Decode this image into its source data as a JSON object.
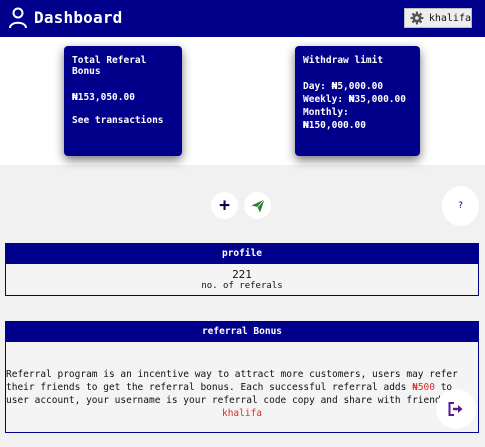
{
  "header": {
    "title": "Dashboard",
    "username": "khalifa"
  },
  "cards": {
    "referral_bonus": {
      "title": "Total Referal Bonus",
      "amount": "₦153,050.00",
      "link": "See transactions"
    },
    "withdraw_limit": {
      "title": "Withdraw limit",
      "day": "Day: ₦5,000.00",
      "weekly": "Weekly: ₦35,000.00",
      "monthly": "Monthly: ₦150,000.00"
    }
  },
  "actions": {
    "add": "+",
    "help": "?"
  },
  "profile": {
    "title": "profile",
    "count": "221",
    "count_label": "no. of referals"
  },
  "referral": {
    "title": "referral Bonus",
    "text_before": "Referral program is an incentive way to attract more customers, users may refer their friends to get the referral bonus. Each successful referral adds ",
    "amount": "₦500",
    "text_after": " to user account, your username is your referral code copy and share with friends.",
    "code": "khalifa"
  },
  "colors": {
    "primary": "#00008b",
    "accent_red": "#d32f2f",
    "send_green": "#2e7d32"
  },
  "icons": [
    "user-icon",
    "gear-icon",
    "plus-icon",
    "send-icon",
    "help-icon",
    "logout-icon"
  ]
}
